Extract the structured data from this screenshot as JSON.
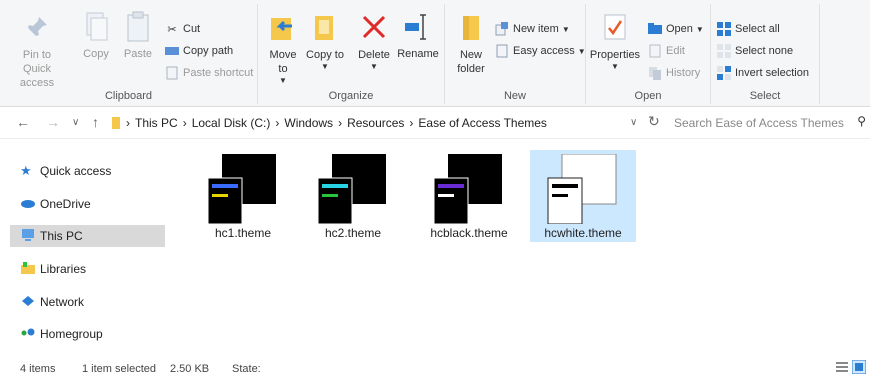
{
  "ribbon": {
    "clipboard": {
      "label": "Clipboard",
      "pin_label": "Pin to Quick access",
      "copy_label": "Copy",
      "paste_label": "Paste",
      "cut_label": "Cut",
      "copy_path_label": "Copy path",
      "paste_shortcut_label": "Paste shortcut"
    },
    "organize": {
      "label": "Organize",
      "move_to_label": "Move to",
      "copy_to_label": "Copy to",
      "delete_label": "Delete",
      "rename_label": "Rename"
    },
    "new": {
      "label": "New",
      "new_folder_label": "New folder",
      "new_item_label": "New item",
      "easy_access_label": "Easy access"
    },
    "open": {
      "label": "Open",
      "properties_label": "Properties",
      "open_label": "Open",
      "edit_label": "Edit",
      "history_label": "History"
    },
    "select": {
      "label": "Select",
      "select_all_label": "Select all",
      "select_none_label": "Select none",
      "invert_label": "Invert selection"
    }
  },
  "address": {
    "crumbs": [
      "This PC",
      "Local Disk (C:)",
      "Windows",
      "Resources",
      "Ease of Access Themes"
    ],
    "search_placeholder": "Search Ease of Access Themes"
  },
  "nav": {
    "items": [
      "Quick access",
      "OneDrive",
      "This PC",
      "Libraries",
      "Network",
      "Homegroup"
    ]
  },
  "files": [
    {
      "name": "hc1.theme",
      "bg": "#000000",
      "bar1": "#3a6bff",
      "bar2": "#e6d300"
    },
    {
      "name": "hc2.theme",
      "bg": "#000000",
      "bar1": "#29d3e6",
      "bar2": "#29c53a"
    },
    {
      "name": "hcblack.theme",
      "bg": "#000000",
      "bar1": "#6a2bd3",
      "bar2": "#ffffff"
    },
    {
      "name": "hcwhite.theme",
      "bg": "#ffffff",
      "bar1": "#000000",
      "bar2": "#000000"
    }
  ],
  "status": {
    "items": "4 items",
    "selected": "1 item selected",
    "size": "2.50 KB",
    "state": "State:"
  },
  "colors": {
    "selection": "#cce8ff",
    "accent": "#2b7cd3"
  }
}
